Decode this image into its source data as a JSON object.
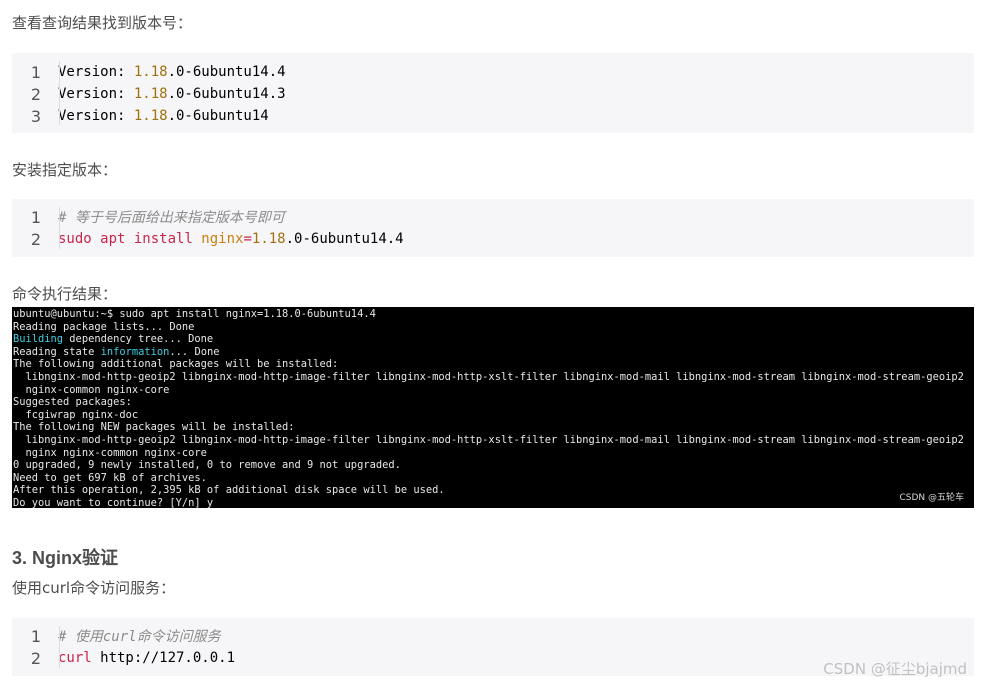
{
  "sections": {
    "intro_1": "查看查询结果找到版本号：",
    "code_1": {
      "lines": [
        {
          "num": "1",
          "tokens": [
            {
              "t": "Version: ",
              "c": "plain"
            },
            {
              "t": "1.18",
              "c": "num"
            },
            {
              "t": ".0-6ubuntu14.4",
              "c": "plain"
            }
          ]
        },
        {
          "num": "2",
          "tokens": [
            {
              "t": "Version: ",
              "c": "plain"
            },
            {
              "t": "1.18",
              "c": "num"
            },
            {
              "t": ".0-6ubuntu14.3",
              "c": "plain"
            }
          ]
        },
        {
          "num": "3",
          "tokens": [
            {
              "t": "Version: ",
              "c": "plain"
            },
            {
              "t": "1.18",
              "c": "num"
            },
            {
              "t": ".0-6ubuntu14",
              "c": "plain"
            }
          ]
        }
      ]
    },
    "intro_2": "安装指定版本：",
    "code_2": {
      "lines": [
        {
          "num": "1",
          "tokens": [
            {
              "t": "# 等于号后面给出来指定版本号即可",
              "c": "comment"
            }
          ]
        },
        {
          "num": "2",
          "tokens": [
            {
              "t": "sudo apt install ",
              "c": "kw"
            },
            {
              "t": "nginx",
              "c": "attr"
            },
            {
              "t": "=",
              "c": "kw"
            },
            {
              "t": "1.18",
              "c": "num"
            },
            {
              "t": ".0-6ubuntu14.4",
              "c": "plain"
            }
          ]
        }
      ]
    },
    "intro_3": "命令执行结果：",
    "terminal": {
      "lines": [
        [
          {
            "t": "ubuntu@ubuntu:~$ sudo apt install nginx=1.18.0-6ubuntu14.4",
            "c": "plain"
          }
        ],
        [
          {
            "t": "Reading package lists... Done",
            "c": "plain"
          }
        ],
        [
          {
            "t": "Building",
            "c": "cyan"
          },
          {
            "t": " dependency tree... Done",
            "c": "plain"
          }
        ],
        [
          {
            "t": "Reading state ",
            "c": "plain"
          },
          {
            "t": "information",
            "c": "cyan"
          },
          {
            "t": "... Done",
            "c": "plain"
          }
        ],
        [
          {
            "t": "The following additional packages will be installed:",
            "c": "plain"
          }
        ],
        [
          {
            "t": "  libnginx-mod-http-geoip2 libnginx-mod-http-image-filter libnginx-mod-http-xslt-filter libnginx-mod-mail libnginx-mod-stream libnginx-mod-stream-geoip2",
            "c": "plain"
          }
        ],
        [
          {
            "t": "  nginx-common nginx-core",
            "c": "plain"
          }
        ],
        [
          {
            "t": "Suggested packages:",
            "c": "plain"
          }
        ],
        [
          {
            "t": "  fcgiwrap nginx-doc",
            "c": "plain"
          }
        ],
        [
          {
            "t": "The following NEW packages will be installed:",
            "c": "plain"
          }
        ],
        [
          {
            "t": "  libnginx-mod-http-geoip2 libnginx-mod-http-image-filter libnginx-mod-http-xslt-filter libnginx-mod-mail libnginx-mod-stream libnginx-mod-stream-geoip2",
            "c": "plain"
          }
        ],
        [
          {
            "t": "  nginx nginx-common nginx-core",
            "c": "plain"
          }
        ],
        [
          {
            "t": "0 upgraded, 9 newly installed, 0 to remove and 9 not upgraded.",
            "c": "plain"
          }
        ],
        [
          {
            "t": "Need to get 697 kB of archives.",
            "c": "plain"
          }
        ],
        [
          {
            "t": "After this operation, 2,395 kB of additional disk space will be used.",
            "c": "plain"
          }
        ],
        [
          {
            "t": "Do you want to continue? [Y/n] y",
            "c": "plain"
          }
        ]
      ],
      "watermark": "CSDN @五轮车"
    },
    "heading_3": "3. Nginx验证",
    "intro_4": "使用curl命令访问服务：",
    "code_3": {
      "lines": [
        {
          "num": "1",
          "tokens": [
            {
              "t": "# 使用curl命令访问服务",
              "c": "comment"
            }
          ]
        },
        {
          "num": "2",
          "tokens": [
            {
              "t": "curl",
              "c": "kw"
            },
            {
              "t": " http://127.0.0.1",
              "c": "plain"
            }
          ]
        }
      ]
    }
  },
  "page_watermark": "CSDN @征尘bjajmd",
  "colors": {
    "text": "#4d4d4d",
    "code_bg": "#f6f6f8",
    "number": "#a0700f",
    "keyword": "#c6274a",
    "attr": "#c97f0f",
    "comment": "#8c8c8c",
    "terminal_bg": "#000000",
    "terminal_cyan": "#3ad0e0"
  }
}
